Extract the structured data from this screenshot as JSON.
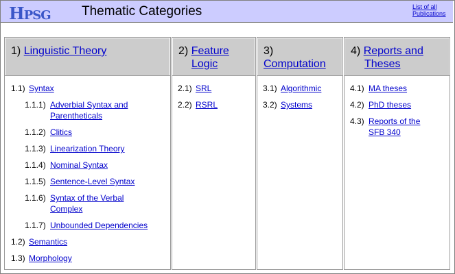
{
  "header": {
    "logo_big": "H",
    "logo_rest": "PSG",
    "title": "Thematic Categories",
    "pubs_link_1": "List of all",
    "pubs_link_2": "Publications"
  },
  "columns": [
    {
      "num": "1)",
      "label": "Linguistic Theory",
      "items": [
        {
          "num": "1.1)",
          "label": "Syntax"
        },
        {
          "num": "1.1.1)",
          "label": "Adverbial Syntax and Parentheticals"
        },
        {
          "num": "1.1.2)",
          "label": "Clitics"
        },
        {
          "num": "1.1.3)",
          "label": "Linearization Theory"
        },
        {
          "num": "1.1.4)",
          "label": "Nominal Syntax"
        },
        {
          "num": "1.1.5)",
          "label": "Sentence-Level Syntax"
        },
        {
          "num": "1.1.6)",
          "label": "Syntax of the Verbal Complex"
        },
        {
          "num": "1.1.7)",
          "label": "Unbounded Dependencies"
        },
        {
          "num": "1.2)",
          "label": "Semantics"
        },
        {
          "num": "1.3)",
          "label": "Morphology"
        }
      ]
    },
    {
      "num": "2)",
      "label": "Feature Logic",
      "items": [
        {
          "num": "2.1)",
          "label": "SRL"
        },
        {
          "num": "2.2)",
          "label": "RSRL"
        }
      ]
    },
    {
      "num": "3)",
      "label": "Computation",
      "items": [
        {
          "num": "3.1)",
          "label": "Algorithmic"
        },
        {
          "num": "3.2)",
          "label": "Systems"
        }
      ]
    },
    {
      "num": "4)",
      "label": "Reports and Theses",
      "items": [
        {
          "num": "4.1)",
          "label": "MA theses"
        },
        {
          "num": "4.2)",
          "label": "PhD theses"
        },
        {
          "num": "4.3)",
          "label": "Reports of the SFB 340"
        }
      ]
    }
  ]
}
